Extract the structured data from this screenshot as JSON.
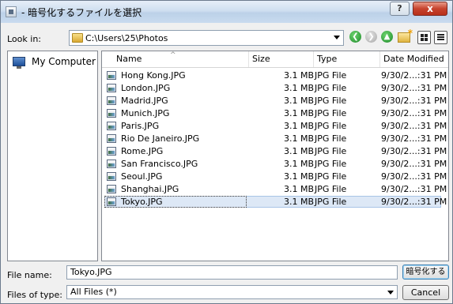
{
  "window": {
    "title": "- 暗号化するファイルを選択",
    "help_label": "?",
    "close_label": "x"
  },
  "toolbar": {
    "look_in_label": "Look in:",
    "look_in_path": "C:\\Users\\25\\Photos"
  },
  "sidebar": {
    "items": [
      {
        "label": "My Computer",
        "icon": "computer-icon"
      }
    ]
  },
  "file_list": {
    "columns": [
      "Name",
      "Size",
      "Type",
      "Date Modified"
    ],
    "rows": [
      {
        "name": "Hong Kong.JPG",
        "size": "3.1 MB",
        "type": "JPG File",
        "date": "9/30/2...:31 PM"
      },
      {
        "name": "London.JPG",
        "size": "3.1 MB",
        "type": "JPG File",
        "date": "9/30/2...:31 PM"
      },
      {
        "name": "Madrid.JPG",
        "size": "3.1 MB",
        "type": "JPG File",
        "date": "9/30/2...:31 PM"
      },
      {
        "name": "Munich.JPG",
        "size": "3.1 MB",
        "type": "JPG File",
        "date": "9/30/2...:31 PM"
      },
      {
        "name": "Paris.JPG",
        "size": "3.1 MB",
        "type": "JPG File",
        "date": "9/30/2...:31 PM"
      },
      {
        "name": "Rio De Janeiro.JPG",
        "size": "3.1 MB",
        "type": "JPG File",
        "date": "9/30/2...:31 PM"
      },
      {
        "name": "Rome.JPG",
        "size": "3.1 MB",
        "type": "JPG File",
        "date": "9/30/2...:31 PM"
      },
      {
        "name": "San Francisco.JPG",
        "size": "3.1 MB",
        "type": "JPG File",
        "date": "9/30/2...:31 PM"
      },
      {
        "name": "Seoul.JPG",
        "size": "3.1 MB",
        "type": "JPG File",
        "date": "9/30/2...:31 PM"
      },
      {
        "name": "Shanghai.JPG",
        "size": "3.1 MB",
        "type": "JPG File",
        "date": "9/30/2...:31 PM"
      },
      {
        "name": "Tokyo.JPG",
        "size": "3.1 MB",
        "type": "JPG File",
        "date": "9/30/2...:31 PM",
        "selected": true
      }
    ]
  },
  "footer": {
    "file_name_label": "File name:",
    "file_name_value": "Tokyo.JPG",
    "file_type_label": "Files of type:",
    "file_type_value": "All Files (*)",
    "open_label": "暗号化する",
    "cancel_label": "Cancel"
  }
}
